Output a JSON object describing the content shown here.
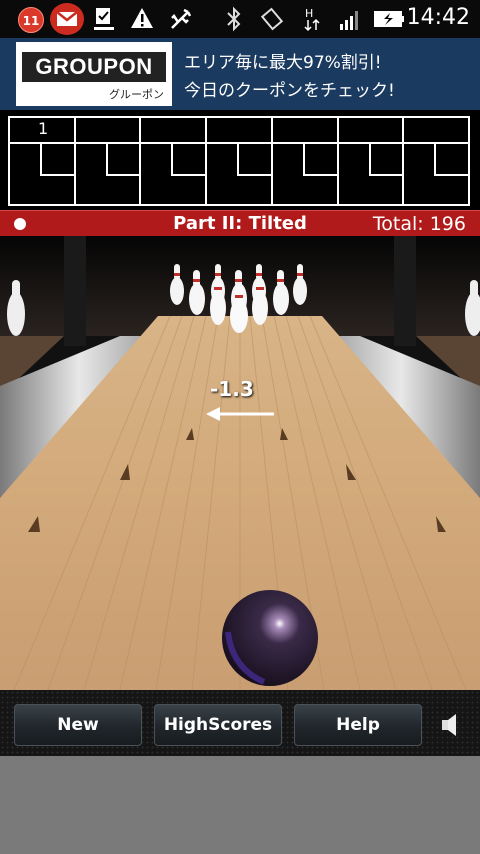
{
  "status_bar": {
    "notification_count": "11",
    "time": "14:42",
    "icons": [
      "gmail-icon",
      "download-done-icon",
      "warning-icon",
      "usb-icon",
      "bluetooth-icon",
      "rotate-icon",
      "data-hspa-icon",
      "signal-icon",
      "battery-charging-icon"
    ]
  },
  "ad": {
    "brand": "GROUPON",
    "brand_sub": "グルーポン",
    "line1": "エリア毎に最大97%割引!",
    "line2": "今日のクーポンをチェック!"
  },
  "scoreboard": {
    "frames": [
      "1",
      "",
      "",
      "",
      "",
      "",
      ""
    ]
  },
  "info_bar": {
    "title": "Part II: Tilted",
    "total": "Total: 196"
  },
  "lane": {
    "aim_value": "-1.3",
    "colors": {
      "wood": "#c9a47a",
      "gutter": "#cfcfcf",
      "ball": "#231a2a"
    }
  },
  "controls": {
    "new_label": "New",
    "highscores_label": "HighScores",
    "help_label": "Help",
    "sound_icon": "speaker-icon"
  }
}
